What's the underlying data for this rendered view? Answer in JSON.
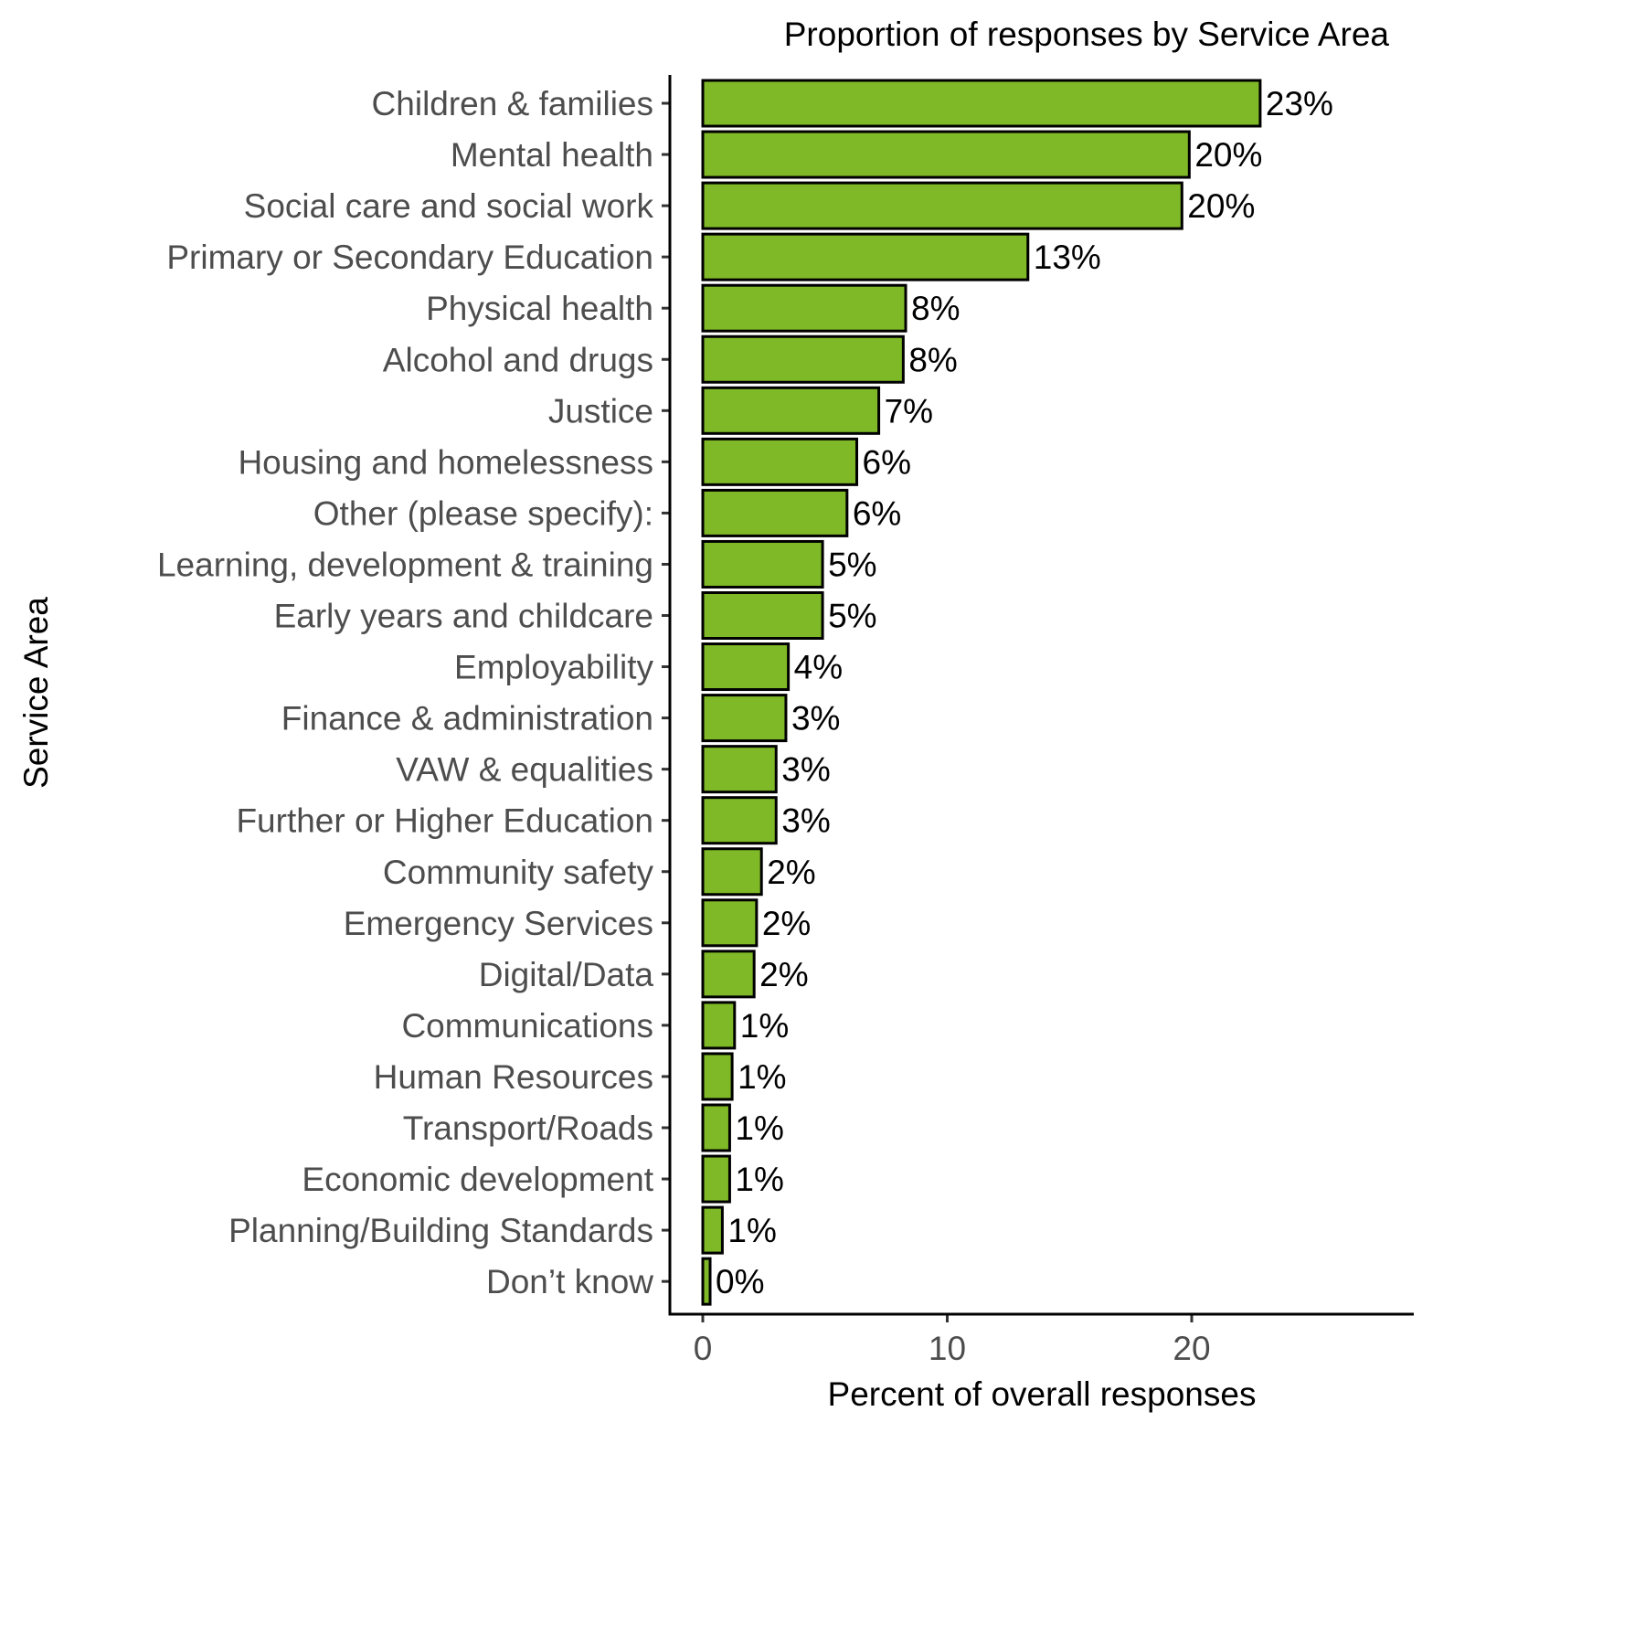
{
  "chart_data": {
    "type": "bar",
    "orientation": "horizontal",
    "title": "Proportion of responses by Service Area",
    "xlabel": "Percent of overall responses",
    "ylabel": "Service Area",
    "xlim": [
      0,
      29.1
    ],
    "xticks": [
      0,
      10,
      20
    ],
    "grid": false,
    "legend": "none",
    "bar_color": "#7FB927",
    "bar_outline": "#000000",
    "categories": [
      "Children & families",
      "Mental health",
      "Social care and social work",
      "Primary or Secondary Education",
      "Physical health",
      "Alcohol and drugs",
      "Justice",
      "Housing and homelessness",
      "Other (please specify):",
      "Learning, development & training",
      "Early years and childcare",
      "Employability",
      "Finance & administration",
      "VAW & equalities",
      "Further or Higher Education",
      "Community safety",
      "Emergency Services",
      "Digital/Data",
      "Communications",
      "Human Resources",
      "Transport/Roads",
      "Economic development",
      "Planning/Building Standards",
      "Don’t know"
    ],
    "values": [
      22.8,
      19.9,
      19.6,
      13.3,
      8.3,
      8.2,
      7.2,
      6.3,
      5.9,
      4.9,
      4.9,
      3.5,
      3.4,
      3.0,
      3.0,
      2.4,
      2.2,
      2.1,
      1.3,
      1.2,
      1.1,
      1.1,
      0.8,
      0.3
    ],
    "data_labels": [
      "23%",
      "20%",
      "20%",
      "13%",
      "8%",
      "8%",
      "7%",
      "6%",
      "6%",
      "5%",
      "5%",
      "4%",
      "3%",
      "3%",
      "3%",
      "2%",
      "2%",
      "2%",
      "1%",
      "1%",
      "1%",
      "1%",
      "1%",
      "0%"
    ]
  }
}
